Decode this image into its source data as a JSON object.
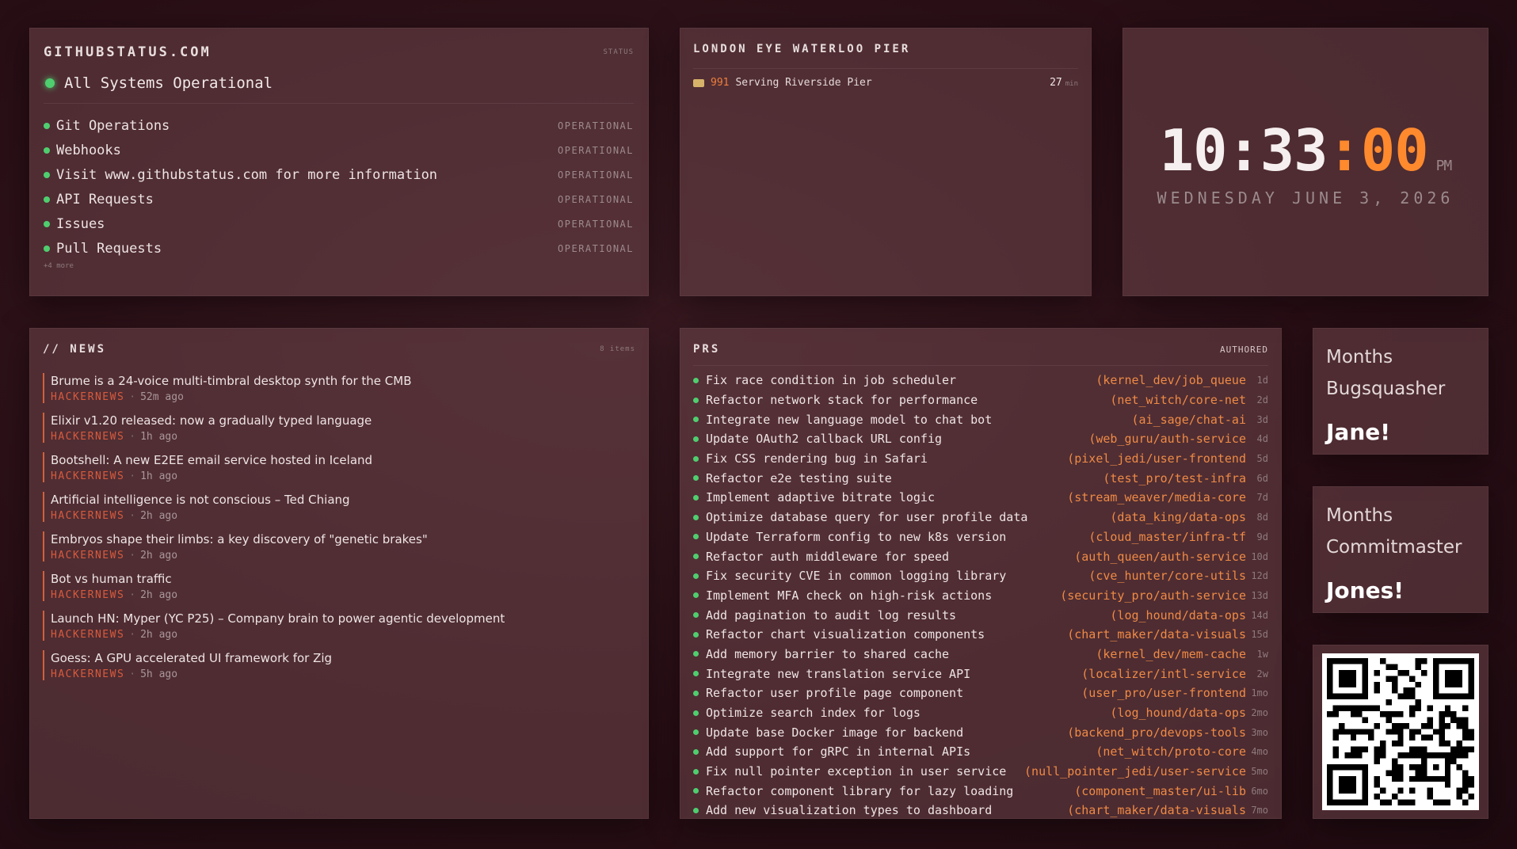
{
  "github": {
    "title": "GITHUBSTATUS.COM",
    "badge": "STATUS",
    "overall": "All Systems Operational",
    "components": [
      {
        "name": "Git Operations",
        "status": "OPERATIONAL"
      },
      {
        "name": "Webhooks",
        "status": "OPERATIONAL"
      },
      {
        "name": "Visit www.githubstatus.com for more information",
        "status": "OPERATIONAL"
      },
      {
        "name": "API Requests",
        "status": "OPERATIONAL"
      },
      {
        "name": "Issues",
        "status": "OPERATIONAL"
      },
      {
        "name": "Pull Requests",
        "status": "OPERATIONAL"
      }
    ],
    "more": "+4 more",
    "status_color": "#4fce6f"
  },
  "transit": {
    "title": "LONDON EYE WATERLOO PIER",
    "departures": [
      {
        "route": "991",
        "destination": "Serving Riverside Pier",
        "minutes": "27",
        "unit": "min"
      }
    ]
  },
  "clock": {
    "hours": "10",
    "sep1": ":",
    "minutes": "33",
    "sep2": ":",
    "seconds": "00",
    "ampm": "PM",
    "date": "WEDNESDAY  JUNE 3, 2026",
    "accent": "#ff8a2e"
  },
  "news": {
    "title": "// NEWS",
    "badge": "8 items",
    "items": [
      {
        "title": "Brume is a 24-voice multi-timbral desktop synth for the CMB",
        "source": "HACKERNEWS",
        "ago": "52m ago"
      },
      {
        "title": "Elixir v1.20 released: now a gradually typed language",
        "source": "HACKERNEWS",
        "ago": "1h ago"
      },
      {
        "title": "Bootshell: A new E2EE email service hosted in Iceland",
        "source": "HACKERNEWS",
        "ago": "1h ago"
      },
      {
        "title": "Artificial intelligence is not conscious – Ted Chiang",
        "source": "HACKERNEWS",
        "ago": "2h ago"
      },
      {
        "title": "Embryos shape their limbs: a key discovery of \"genetic brakes\"",
        "source": "HACKERNEWS",
        "ago": "2h ago"
      },
      {
        "title": "Bot vs human traffic",
        "source": "HACKERNEWS",
        "ago": "2h ago"
      },
      {
        "title": "Launch HN: Myper (YC P25) – Company brain to power agentic development",
        "source": "HACKERNEWS",
        "ago": "2h ago"
      },
      {
        "title": "Goess: A GPU accelerated UI framework for Zig",
        "source": "HACKERNEWS",
        "ago": "5h ago"
      }
    ]
  },
  "prs": {
    "title": "PRS",
    "tag": "AUTHORED",
    "items": [
      {
        "title": "Fix race condition in job scheduler",
        "repo": "(kernel_dev/job_queue",
        "age": "1d"
      },
      {
        "title": "Refactor network stack for performance",
        "repo": "(net_witch/core-net",
        "age": "2d"
      },
      {
        "title": "Integrate new language model to chat bot",
        "repo": "(ai_sage/chat-ai",
        "age": "3d"
      },
      {
        "title": "Update OAuth2 callback URL config",
        "repo": "(web_guru/auth-service",
        "age": "4d"
      },
      {
        "title": "Fix CSS rendering bug in Safari",
        "repo": "(pixel_jedi/user-frontend",
        "age": "5d"
      },
      {
        "title": "Refactor e2e testing suite",
        "repo": "(test_pro/test-infra",
        "age": "6d"
      },
      {
        "title": "Implement adaptive bitrate logic",
        "repo": "(stream_weaver/media-core",
        "age": "7d"
      },
      {
        "title": "Optimize database query for user profile data",
        "repo": "(data_king/data-ops",
        "age": "8d"
      },
      {
        "title": "Update Terraform config to new k8s version",
        "repo": "(cloud_master/infra-tf",
        "age": "9d"
      },
      {
        "title": "Refactor auth middleware for speed",
        "repo": "(auth_queen/auth-service",
        "age": "10d"
      },
      {
        "title": "Fix security CVE in common logging library",
        "repo": "(cve_hunter/core-utils",
        "age": "12d"
      },
      {
        "title": "Implement MFA check on high-risk actions",
        "repo": "(security_pro/auth-service",
        "age": "13d"
      },
      {
        "title": "Add pagination to audit log results",
        "repo": "(log_hound/data-ops",
        "age": "14d"
      },
      {
        "title": "Refactor chart visualization components",
        "repo": "(chart_maker/data-visuals",
        "age": "15d"
      },
      {
        "title": "Add memory barrier to shared cache",
        "repo": "(kernel_dev/mem-cache",
        "age": "1w"
      },
      {
        "title": "Integrate new translation service API",
        "repo": "(localizer/intl-service",
        "age": "2w"
      },
      {
        "title": "Refactor user profile page component",
        "repo": "(user_pro/user-frontend",
        "age": "1mo"
      },
      {
        "title": "Optimize search index for logs",
        "repo": "(log_hound/data-ops",
        "age": "2mo"
      },
      {
        "title": "Update base Docker image for backend",
        "repo": "(backend_pro/devops-tools",
        "age": "3mo"
      },
      {
        "title": "Add support for gRPC in internal APIs",
        "repo": "(net_witch/proto-core",
        "age": "4mo"
      },
      {
        "title": "Fix null pointer exception in user service",
        "repo": "(null_pointer_jedi/user-service",
        "age": "5mo"
      },
      {
        "title": "Refactor component library for lazy loading",
        "repo": "(component_master/ui-lib",
        "age": "6mo"
      },
      {
        "title": "Add new visualization types to dashboard",
        "repo": "(chart_maker/data-visuals",
        "age": "7mo"
      }
    ]
  },
  "kudos": [
    {
      "line1": "Months",
      "line2": "Bugsquasher",
      "name": "Jane!"
    },
    {
      "line1": "Months",
      "line2": "Commitmaster",
      "name": "Jones!"
    }
  ],
  "qr": {
    "icon": "qr-code-icon"
  }
}
